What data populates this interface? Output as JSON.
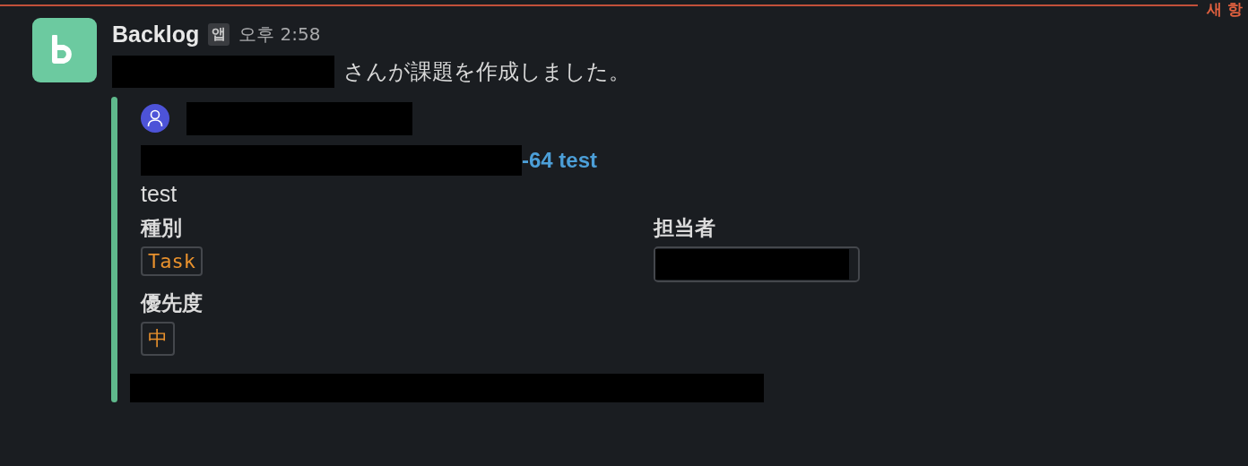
{
  "divider": {
    "label": "새 항"
  },
  "message": {
    "sender": "Backlog",
    "badge": "앱",
    "time": "오후 2:58",
    "text": "さんが課題を作成しました。",
    "attachment": {
      "link_suffix": "-64 test",
      "description": "test",
      "fields": [
        {
          "kind": "tag",
          "label": "種別",
          "value": "Task"
        },
        {
          "kind": "redacted",
          "label": "担当者"
        },
        {
          "kind": "tag",
          "label": "優先度",
          "value": "中"
        }
      ]
    }
  }
}
